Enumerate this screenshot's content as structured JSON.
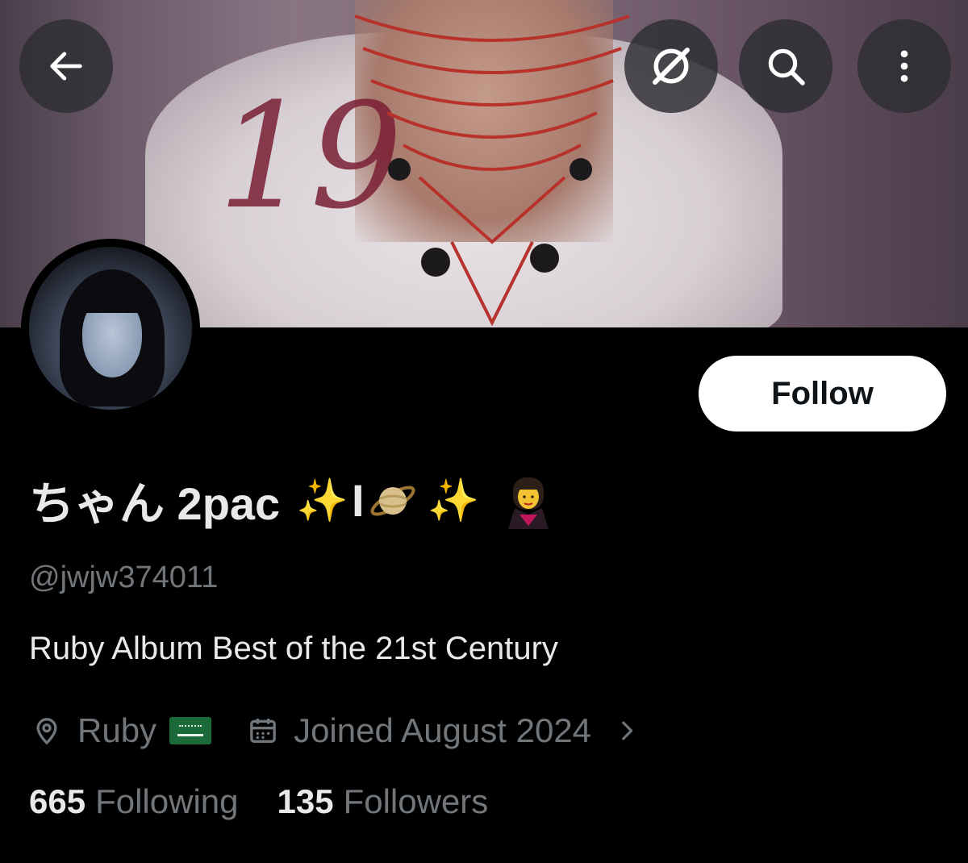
{
  "header": {
    "back_icon": "arrow-left-icon",
    "grok_icon": "grok-icon",
    "search_icon": "search-icon",
    "more_icon": "more-vertical-icon"
  },
  "profile": {
    "follow_label": "Follow",
    "display_name": "ちゃん 2pac",
    "name_emojis": [
      "✨",
      "I",
      "🪐",
      "✨",
      "🧛‍♀️"
    ],
    "handle": "@jwjw374011",
    "bio": "Ruby Album Best of the 21st Century",
    "location": "Ruby",
    "location_flag": "saudi-arabia-flag",
    "joined": "Joined August 2024",
    "following_count": "665",
    "following_label": "Following",
    "followers_count": "135",
    "followers_label": "Followers"
  },
  "colors": {
    "background": "#000000",
    "primary_text": "#e7e9ea",
    "secondary_text": "#71767b",
    "follow_button_bg": "#ffffff"
  }
}
